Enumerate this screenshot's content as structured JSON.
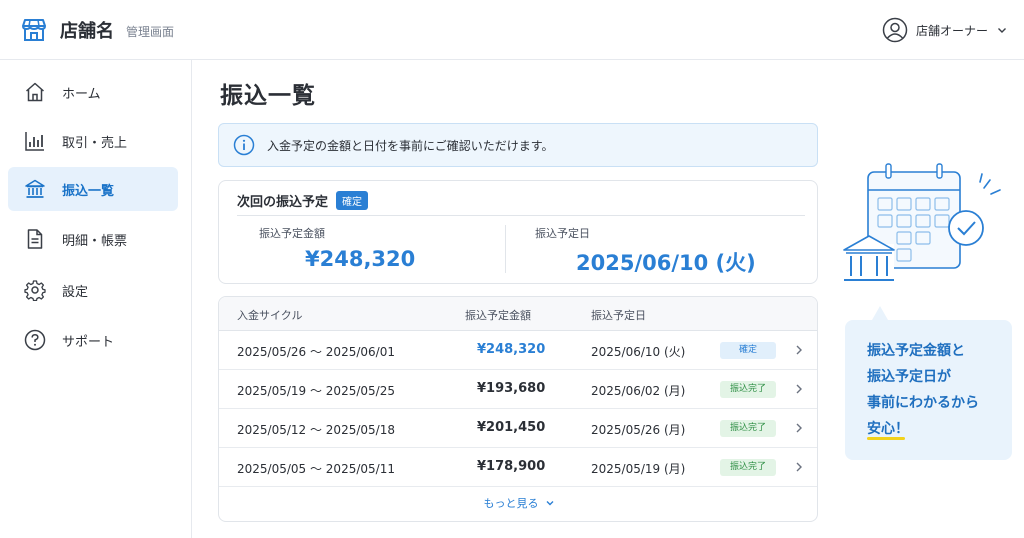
{
  "header": {
    "shop_name": "店舗名",
    "subtitle": "管理画面",
    "user_name": "店舗オーナー"
  },
  "sidebar": {
    "items": [
      {
        "label": "ホーム",
        "icon": "home-icon"
      },
      {
        "label": "取引・売上",
        "icon": "bar-chart-icon"
      },
      {
        "label": "振込一覧",
        "icon": "bank-icon",
        "active": true
      },
      {
        "label": "明細・帳票",
        "icon": "document-icon"
      },
      {
        "label": "設定",
        "icon": "gear-icon"
      },
      {
        "label": "サポート",
        "icon": "help-icon"
      }
    ]
  },
  "main": {
    "title": "振込一覧",
    "info_text": "入金予定の金額と日付を事前にご確認いただけます。",
    "next_transfer": {
      "title": "次回の振込予定",
      "badge": "確定",
      "amount_label": "振込予定金額",
      "amount": "¥248,320",
      "date_label": "振込予定日",
      "date": "2025/06/10 (火)"
    },
    "table": {
      "headers": [
        "入金サイクル",
        "振込予定金額",
        "振込予定日"
      ],
      "rows": [
        {
          "cycle": "2025/05/26 〜 2025/06/01",
          "amount": "¥248,320",
          "date": "2025/06/10 (火)",
          "status": "確定"
        },
        {
          "cycle": "2025/05/19 〜 2025/05/25",
          "amount": "¥193,680",
          "date": "2025/06/02 (月)",
          "status": "振込完了"
        },
        {
          "cycle": "2025/05/12 〜 2025/05/18",
          "amount": "¥201,450",
          "date": "2025/05/26 (月)",
          "status": "振込完了"
        },
        {
          "cycle": "2025/05/05 〜 2025/05/11",
          "amount": "¥178,900",
          "date": "2025/05/19 (月)",
          "status": "振込完了"
        }
      ],
      "more_label": "もっと見る"
    }
  },
  "callout": {
    "lines": [
      "振込予定金額と",
      "振込予定日が",
      "事前にわかるから",
      "安心！"
    ]
  },
  "colors": {
    "accent": "#2a7fd4",
    "active_bg": "#e6f1fc",
    "done_green": "#2f8f45",
    "highlight_yellow": "#f2d21b"
  }
}
